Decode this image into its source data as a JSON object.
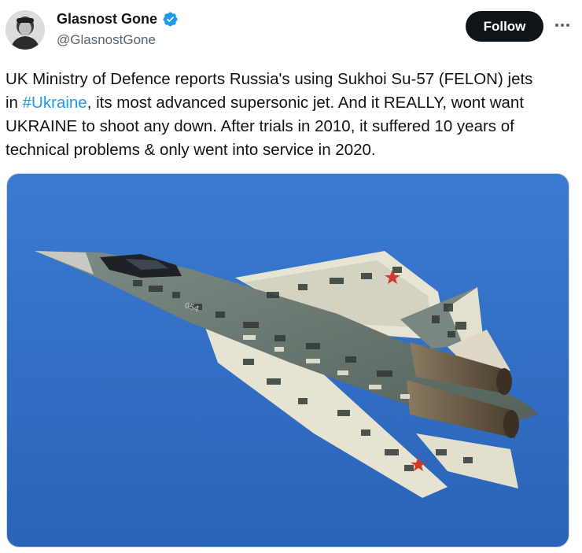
{
  "author": {
    "display_name": "Glasnost Gone",
    "handle": "@GlasnostGone",
    "verified": true,
    "verified_color": "#1d9bf0"
  },
  "actions": {
    "follow_label": "Follow",
    "more_icon": "more-horizontal-icon"
  },
  "tweet": {
    "text_part1": "UK Ministry of Defence reports Russia's using Sukhoi Su-57 (FELON) jets\nin ",
    "hashtag": "#Ukraine",
    "text_part2": ", its most advanced supersonic jet. And it REALLY, wont want\nUKRAINE to shoot any down. After trials in 2010, it suffered 10 years of\ntechnical problems & only went into service in 2020."
  },
  "media": {
    "sky_color": "#2f6fc4",
    "tail_number": "054"
  },
  "colors": {
    "text": "#0f1419",
    "secondary": "#536471",
    "link": "#1d9bf0",
    "follow_bg": "#0f1419"
  }
}
